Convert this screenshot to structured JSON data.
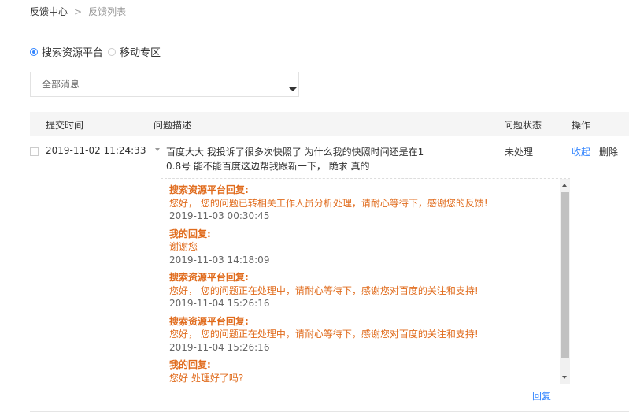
{
  "breadcrumb": {
    "home": "反馈中心",
    "separator": ">",
    "current": "反馈列表"
  },
  "platform_options": {
    "option1": "搜索资源平台",
    "option2": "移动专区",
    "selected": "搜索资源平台"
  },
  "filter": {
    "selected": "全部消息"
  },
  "table": {
    "headers": {
      "time": "提交时间",
      "description": "问题描述",
      "status": "问题状态",
      "actions": "操作"
    }
  },
  "feedback": {
    "time": "2019-11-02 11:24:33",
    "description": "百度大大 我投诉了很多次快照了 为什么我的快照时间还是在1 0.8号 能不能百度这边帮我跟新一下， 跪求 真的",
    "status": "未处理",
    "collapse_label": "收起",
    "delete_label": "删除",
    "replies": [
      {
        "who": "搜索资源平台回复:",
        "message": "您好， 您的问题已转相关工作人员分析处理，请耐心等待下，感谢您的反馈!",
        "time": "2019-11-03 00:30:45"
      },
      {
        "who": "我的回复:",
        "message": "谢谢您",
        "time": "2019-11-03 14:18:09"
      },
      {
        "who": "搜索资源平台回复:",
        "message": "您好， 您的问题正在处理中，请耐心等待下，感谢您对百度的关注和支持!",
        "time": "2019-11-04 15:26:16"
      },
      {
        "who": "搜索资源平台回复:",
        "message": "您好， 您的问题正在处理中，请耐心等待下，感谢您对百度的关注和支持!",
        "time": "2019-11-04 15:26:16"
      },
      {
        "who": "我的回复:",
        "message": "您好 处理好了吗?",
        "time": ""
      }
    ],
    "reply_label": "回复"
  },
  "colors": {
    "accent": "#3385ff",
    "reply_text": "#e06b1c",
    "header_bg": "#f5f5f5"
  }
}
